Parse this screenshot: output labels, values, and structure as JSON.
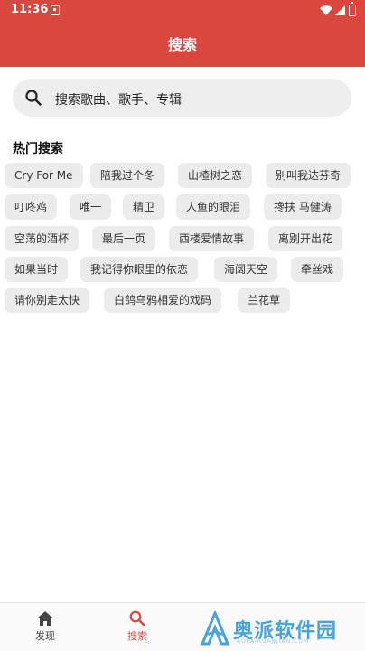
{
  "status_bar": {
    "time": "11:36"
  },
  "header": {
    "title": "搜索"
  },
  "search": {
    "placeholder": "搜索歌曲、歌手、专辑"
  },
  "hot_search": {
    "title": "热门搜索",
    "items": [
      "Cry For Me",
      "陪我过个冬",
      "山楂树之恋",
      "别叫我达芬奇",
      "叮咚鸡",
      "唯一",
      "精卫",
      "人鱼的眼泪",
      "搀扶 马健涛",
      "空荡的酒杯",
      "最后一页",
      "西楼爱情故事",
      "离别开出花",
      "如果当时",
      "我记得你眼里的依恋",
      "海阔天空",
      "牵丝戏",
      "请你别走太快",
      "白鸽乌鸦相爱的戏码",
      "兰花草"
    ]
  },
  "bottom_nav": {
    "items": [
      {
        "label": "发现",
        "icon": "home-icon",
        "active": false
      },
      {
        "label": "搜索",
        "icon": "search-icon",
        "active": true
      }
    ]
  },
  "watermark": {
    "text": "奥派软件园",
    "subtext": "AOPAIRUANJIAN.COM"
  },
  "colors": {
    "accent": "#d9473e",
    "chip_bg": "#ececec",
    "search_bg": "#eeeeee",
    "watermark": "#4aa3d6"
  }
}
